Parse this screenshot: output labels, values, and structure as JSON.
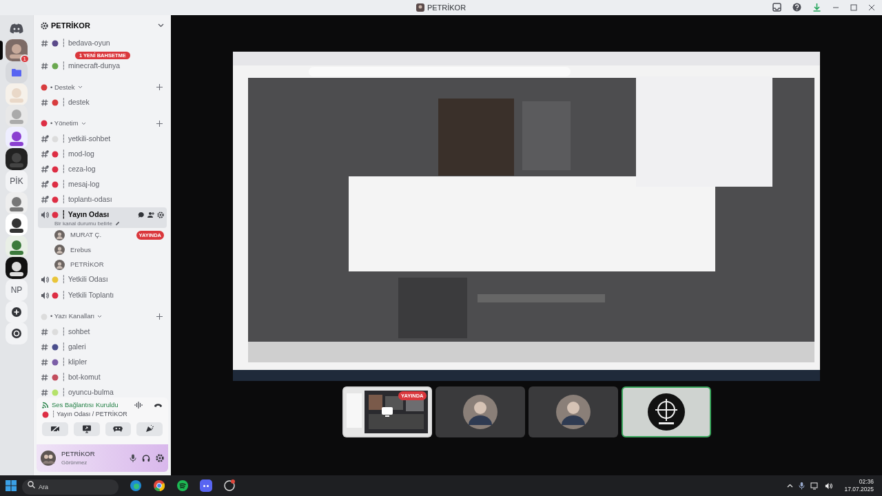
{
  "window": {
    "title": "PETRİKOR"
  },
  "server_rail": [
    {
      "kind": "discord",
      "selected": false
    },
    {
      "kind": "picture",
      "selected": true,
      "badge": "1"
    },
    {
      "kind": "folder",
      "selected": false
    },
    {
      "kind": "picture",
      "selected": false
    },
    {
      "kind": "picture",
      "selected": false
    },
    {
      "kind": "picture",
      "selected": false
    },
    {
      "kind": "picture",
      "selected": false
    },
    {
      "kind": "label",
      "label": "PİK",
      "selected": false
    },
    {
      "kind": "picture",
      "selected": false
    },
    {
      "kind": "picture",
      "selected": false
    },
    {
      "kind": "picture",
      "selected": false
    },
    {
      "kind": "picture",
      "selected": false
    },
    {
      "kind": "label",
      "label": "NP",
      "selected": false
    },
    {
      "kind": "add",
      "selected": false
    },
    {
      "kind": "explore",
      "selected": false
    }
  ],
  "server": {
    "name": "PETRİKOR"
  },
  "mention_pill": "1 YENİ BAHSETME",
  "channels": [
    {
      "kind": "text",
      "name": "┆ bedava-oyun",
      "color": "#5b4a8a",
      "locked": false
    },
    {
      "kind": "text",
      "name": "┆ minecraft-dunya",
      "color": "#6aa84f",
      "locked": false
    },
    {
      "kind": "category",
      "name": "• Destek",
      "color": "#d83c3e"
    },
    {
      "kind": "text",
      "name": "┆ destek",
      "color": "#d83c3e",
      "locked": false
    },
    {
      "kind": "category",
      "name": "• Yönetim",
      "color": "#dd2e44"
    },
    {
      "kind": "text",
      "name": "┆ yetkili-sohbet",
      "color": "#dcdcdc",
      "locked": true
    },
    {
      "kind": "text",
      "name": "┆ mod-log",
      "color": "#dd2e44",
      "locked": true
    },
    {
      "kind": "text",
      "name": "┆ ceza-log",
      "color": "#dd2e44",
      "locked": true
    },
    {
      "kind": "text",
      "name": "┆ mesaj-log",
      "color": "#dd2e44",
      "locked": true
    },
    {
      "kind": "text",
      "name": "┆ toplantı-odası",
      "color": "#dd2e44",
      "locked": true
    },
    {
      "kind": "voice",
      "name": "┆ Yayın Odası",
      "color": "#dd2e44",
      "selected": true,
      "status": "Bir kanal durumu belirle",
      "members": [
        {
          "name": "MURAT Ç.",
          "badge": "YAYINDA"
        },
        {
          "name": "Erebus"
        },
        {
          "name": "PETRİKOR"
        }
      ]
    },
    {
      "kind": "voice",
      "name": "┆ Yetkili Odası",
      "color": "#e9c53a",
      "selected": false
    },
    {
      "kind": "voice",
      "name": "┆ Yetkili Toplantı",
      "color": "#dd2e44",
      "selected": false
    },
    {
      "kind": "category",
      "name": "• Yazı Kanalları",
      "color": "#dcdcdc"
    },
    {
      "kind": "text",
      "name": "┆ sohbet",
      "color": "#dcdcdc",
      "locked": false
    },
    {
      "kind": "text",
      "name": "┆ galeri",
      "color": "#4a4e8c",
      "locked": false
    },
    {
      "kind": "text",
      "name": "┆ klipler",
      "color": "#7b5ea7",
      "locked": false
    },
    {
      "kind": "text",
      "name": "┆ bot-komut",
      "color": "#c24d5d",
      "locked": false
    },
    {
      "kind": "text",
      "name": "┆ oyuncu-bulma",
      "color": "#b5e26a",
      "locked": false
    }
  ],
  "voice_panel": {
    "status": "Ses Bağlantısı Kuruldu",
    "channel": "┆ Yayın Odası / PETRİKOR"
  },
  "user_panel": {
    "name": "PETRİKOR",
    "presence": "Görünmez"
  },
  "stream": {
    "kind": "picture"
  },
  "tiles": [
    {
      "kind": "stream",
      "badge": "YAYINDA",
      "speaking": false
    },
    {
      "kind": "avatar",
      "speaking": false
    },
    {
      "kind": "avatar",
      "speaking": false
    },
    {
      "kind": "logo",
      "speaking": true
    }
  ],
  "taskbar": {
    "search": {
      "placeholder": "Ara"
    },
    "time": "02:36",
    "date": "17.07.2025"
  }
}
